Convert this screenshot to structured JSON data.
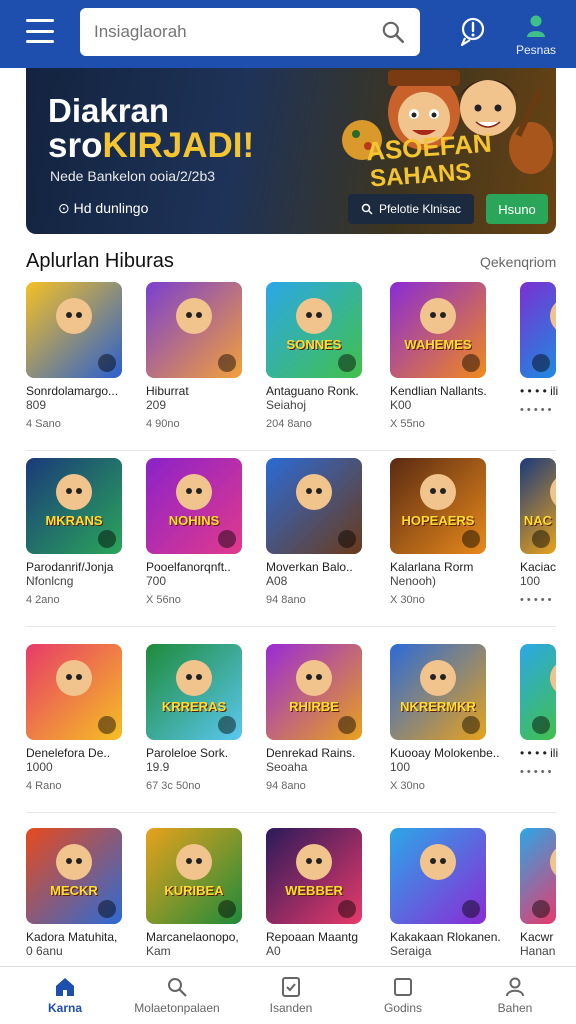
{
  "header": {
    "search_placeholder": "Insiaglaorah",
    "profile_label": "Pesnas"
  },
  "banner": {
    "title_line1": "Diakran",
    "title_line2_a": "sro",
    "title_line2_b": "KIRJADI!",
    "subtitle": "Nede Bankelon ooia/2/2b3",
    "meta": "Hd dunlingo",
    "secondary_button": "Pfelotie Klnisac",
    "primary_button": "Hsuno",
    "art_text_line1": "ASOEFAN",
    "art_text_line2": "SAHANS"
  },
  "section": {
    "title": "Aplurlan Hiburas",
    "more_label": "Qekenqriom"
  },
  "rows": [
    {
      "items": [
        {
          "name": "Sonrdolamargo...",
          "size": "809",
          "rating": "4 Sano",
          "thumb_text": "",
          "colors": [
            "#f5c023",
            "#2a5fcf"
          ]
        },
        {
          "name": "Hiburrat",
          "size": "209",
          "rating": "4 90no",
          "thumb_text": "",
          "colors": [
            "#7a3fd0",
            "#f2a13a"
          ]
        },
        {
          "name": "Antaguano Ronk.",
          "size": "Seiahoj",
          "rating": "204 8ano",
          "thumb_text": "SONNES",
          "colors": [
            "#2ba7e8",
            "#43c04a"
          ]
        },
        {
          "name": "Kendlian Nallants.",
          "size": "K00",
          "rating": "X 55no",
          "thumb_text": "WAHEMES",
          "colors": [
            "#8a2bd6",
            "#f08a1c"
          ]
        },
        {
          "name": "• • • • ili",
          "size": "",
          "rating": "• • • • •",
          "thumb_text": "",
          "colors": [
            "#7b2fd1",
            "#1e8be0"
          ]
        }
      ]
    },
    {
      "items": [
        {
          "name": "Parodanrif/Jonja",
          "size": "Nfonlcng",
          "rating": "4 2ano",
          "thumb_text": "MKRANS",
          "colors": [
            "#1b3a7a",
            "#2aa65a"
          ]
        },
        {
          "name": "Pooelfanorqnft..",
          "size": "700",
          "rating": "X 56no",
          "thumb_text": "NOHINS",
          "colors": [
            "#8b22c9",
            "#e23a8c"
          ]
        },
        {
          "name": "Moverkan Balo..",
          "size": "A08",
          "rating": "94 8ano",
          "thumb_text": "",
          "colors": [
            "#2b6bd6",
            "#6b3a1a"
          ]
        },
        {
          "name": "Kalarlana Rorm",
          "size": "Nenooh)",
          "rating": "X 30no",
          "thumb_text": "HOPEAERS",
          "colors": [
            "#5a2a12",
            "#e88a1c"
          ]
        },
        {
          "name": "Kaciac",
          "size": "100",
          "rating": "• • • • •",
          "thumb_text": "NAC",
          "colors": [
            "#1b3a7a",
            "#e8a21c"
          ]
        }
      ]
    },
    {
      "items": [
        {
          "name": "Denelefora De..",
          "size": "1000",
          "rating": "4 Rano",
          "thumb_text": "",
          "colors": [
            "#e83a6a",
            "#f5c023"
          ]
        },
        {
          "name": "Paroleloe Sork.",
          "size": "19.9",
          "rating": "67 3c 50no",
          "thumb_text": "KRRERAS",
          "colors": [
            "#1e8a3a",
            "#5ac8f0"
          ]
        },
        {
          "name": "Denrekad Rains.",
          "size": "Seoaha",
          "rating": "94 8ano",
          "thumb_text": "RHIRBE",
          "colors": [
            "#9a2bd6",
            "#e8a21c"
          ]
        },
        {
          "name": "Kuooay Molokenbe..",
          "size": "100",
          "rating": "X 30no",
          "thumb_text": "NKRERMKR",
          "colors": [
            "#2b6bd6",
            "#e8a21c"
          ]
        },
        {
          "name": "• • • • ili",
          "size": "",
          "rating": "• • • • •",
          "thumb_text": "",
          "colors": [
            "#2ba7e8",
            "#43c04a"
          ]
        }
      ]
    },
    {
      "items": [
        {
          "name": "Kadora Matuhita,",
          "size": "0 6anu",
          "rating": "",
          "thumb_text": "MECKR",
          "colors": [
            "#e84a1c",
            "#2b6bd6"
          ]
        },
        {
          "name": "Marcanelaonopo,",
          "size": "Kam",
          "rating": "",
          "thumb_text": "KURIBEA",
          "colors": [
            "#e8a21c",
            "#1e8a3a"
          ]
        },
        {
          "name": "Repoaan Maantg",
          "size": "A0",
          "rating": "",
          "thumb_text": "WEBBER",
          "colors": [
            "#2a1a5a",
            "#e83a6a"
          ]
        },
        {
          "name": "Kakakaan Rlokanen.",
          "size": "Seraiga",
          "rating": "",
          "thumb_text": "",
          "colors": [
            "#2ba7e8",
            "#8a2bd6"
          ]
        },
        {
          "name": "Kacwr",
          "size": "Hanan",
          "rating": "",
          "thumb_text": "",
          "colors": [
            "#2ba7e8",
            "#e83a6a"
          ]
        }
      ]
    }
  ],
  "bottom_nav": [
    {
      "label": "Karna",
      "icon": "home-icon",
      "active": true
    },
    {
      "label": "Molaetonpalaen",
      "icon": "search-icon",
      "active": false
    },
    {
      "label": "Isanden",
      "icon": "library-icon",
      "active": false
    },
    {
      "label": "Godins",
      "icon": "square-icon",
      "active": false
    },
    {
      "label": "Bahen",
      "icon": "person-icon",
      "active": false
    }
  ],
  "colors": {
    "brand": "#1e4fae",
    "accent_green": "#2aa65a",
    "accent_gold": "#f4c531"
  }
}
